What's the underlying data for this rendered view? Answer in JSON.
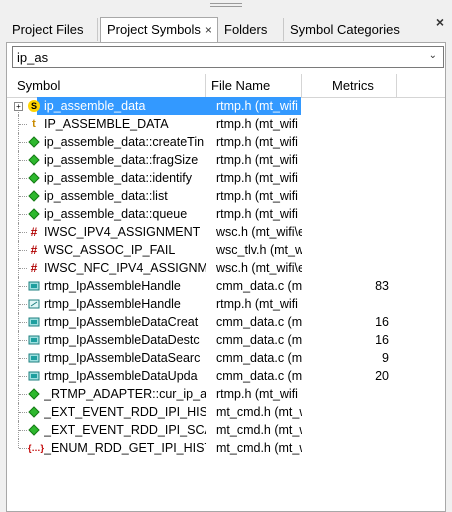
{
  "tabs": [
    {
      "label": "Project Files"
    },
    {
      "label": "Project Symbols",
      "close": "×"
    },
    {
      "label": "Folders"
    },
    {
      "label": "Symbol Categories"
    }
  ],
  "close_glyph": "×",
  "search": {
    "value": "ip_as",
    "dropdown_glyph": "⌄"
  },
  "columns": {
    "symbol": "Symbol",
    "file": "File Name",
    "metrics": "Metrics"
  },
  "rows": [
    {
      "icon": "struct-icon",
      "symbol": "ip_assemble_data",
      "file": "rtmp.h (mt_wifi",
      "metrics": "",
      "selected": true
    },
    {
      "icon": "typedef-icon",
      "symbol": "IP_ASSEMBLE_DATA",
      "file": "rtmp.h (mt_wifi",
      "metrics": ""
    },
    {
      "icon": "member-icon",
      "symbol": "ip_assemble_data::createTin",
      "file": "rtmp.h (mt_wifi",
      "metrics": ""
    },
    {
      "icon": "member-icon",
      "symbol": "ip_assemble_data::fragSize",
      "file": "rtmp.h (mt_wifi",
      "metrics": ""
    },
    {
      "icon": "member-icon",
      "symbol": "ip_assemble_data::identify",
      "file": "rtmp.h (mt_wifi",
      "metrics": ""
    },
    {
      "icon": "member-icon",
      "symbol": "ip_assemble_data::list",
      "file": "rtmp.h (mt_wifi",
      "metrics": ""
    },
    {
      "icon": "member-icon",
      "symbol": "ip_assemble_data::queue",
      "file": "rtmp.h (mt_wifi",
      "metrics": ""
    },
    {
      "icon": "macro-icon",
      "symbol": "IWSC_IPV4_ASSIGNMENT",
      "file": "wsc.h (mt_wifi\\e",
      "metrics": ""
    },
    {
      "icon": "macro-icon",
      "symbol": "WSC_ASSOC_IP_FAIL",
      "file": "wsc_tlv.h (mt_w",
      "metrics": ""
    },
    {
      "icon": "macro-icon",
      "symbol": "IWSC_NFC_IPV4_ASSIGNME",
      "file": "wsc.h (mt_wifi\\e",
      "metrics": ""
    },
    {
      "icon": "function-icon",
      "symbol": "rtmp_IpAssembleHandle",
      "file": "cmm_data.c (m",
      "metrics": "83"
    },
    {
      "icon": "prototype-icon",
      "symbol": "rtmp_IpAssembleHandle",
      "file": "rtmp.h (mt_wifi",
      "metrics": ""
    },
    {
      "icon": "function-icon",
      "symbol": "rtmp_IpAssembleDataCreat",
      "file": "cmm_data.c (m",
      "metrics": "16"
    },
    {
      "icon": "function-icon",
      "symbol": "rtmp_IpAssembleDataDestc",
      "file": "cmm_data.c (m",
      "metrics": "16"
    },
    {
      "icon": "function-icon",
      "symbol": "rtmp_IpAssembleDataSearc",
      "file": "cmm_data.c (m",
      "metrics": "9"
    },
    {
      "icon": "function-icon",
      "symbol": "rtmp_IpAssembleDataUpda",
      "file": "cmm_data.c (m",
      "metrics": "20"
    },
    {
      "icon": "member-icon",
      "symbol": "_RTMP_ADAPTER::cur_ip_ass",
      "file": "rtmp.h (mt_wifi",
      "metrics": ""
    },
    {
      "icon": "member-icon",
      "symbol": "_EXT_EVENT_RDD_IPI_HIST::",
      "file": "mt_cmd.h (mt_w",
      "metrics": ""
    },
    {
      "icon": "member-icon",
      "symbol": "_EXT_EVENT_RDD_IPI_SCAN",
      "file": "mt_cmd.h (mt_w",
      "metrics": ""
    },
    {
      "icon": "enum-icon",
      "symbol": "_ENUM_RDD_GET_IPI_HIST_",
      "file": "mt_cmd.h (mt_w",
      "metrics": ""
    }
  ]
}
